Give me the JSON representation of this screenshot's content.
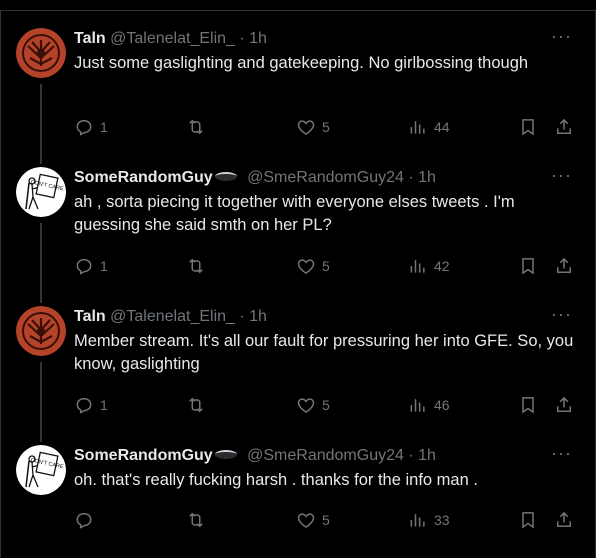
{
  "tweets": [
    {
      "name": "Taln",
      "handle": "@Talenelat_Elin_",
      "sep": "·",
      "time": "1h",
      "text": "Just some gaslighting and gatekeeping. No girlbossing though",
      "replies": "1",
      "retweets": "",
      "likes": "5",
      "views": "44",
      "avatar": "red-sigil"
    },
    {
      "name": "SomeRandomGuy",
      "handle": "@SmeRandomGuy24",
      "sep": "·",
      "time": "1h",
      "text": "ah , sorta piecing it together with everyone elses tweets . I'm guessing she said smth on her PL?",
      "replies": "1",
      "retweets": "",
      "likes": "5",
      "views": "42",
      "avatar": "dont-care-sign"
    },
    {
      "name": "Taln",
      "handle": "@Talenelat_Elin_",
      "sep": "·",
      "time": "1h",
      "text": "Member stream. It's all our fault for pressuring her into GFE. So, you know, gaslighting",
      "replies": "1",
      "retweets": "",
      "likes": "5",
      "views": "46",
      "avatar": "red-sigil"
    },
    {
      "name": "SomeRandomGuy",
      "handle": "@SmeRandomGuy24",
      "sep": "·",
      "time": "1h",
      "text": "oh. that's really fucking harsh . thanks for the info man .",
      "replies": "",
      "retweets": "",
      "likes": "5",
      "views": "33",
      "avatar": "dont-care-sign"
    }
  ],
  "more_label": "···",
  "avatar_sign_text": "DON'T CARE",
  "colors": {
    "background": "#000000",
    "text": "#e7e9ea",
    "muted": "#71767b",
    "sigil": "#b5432a"
  }
}
